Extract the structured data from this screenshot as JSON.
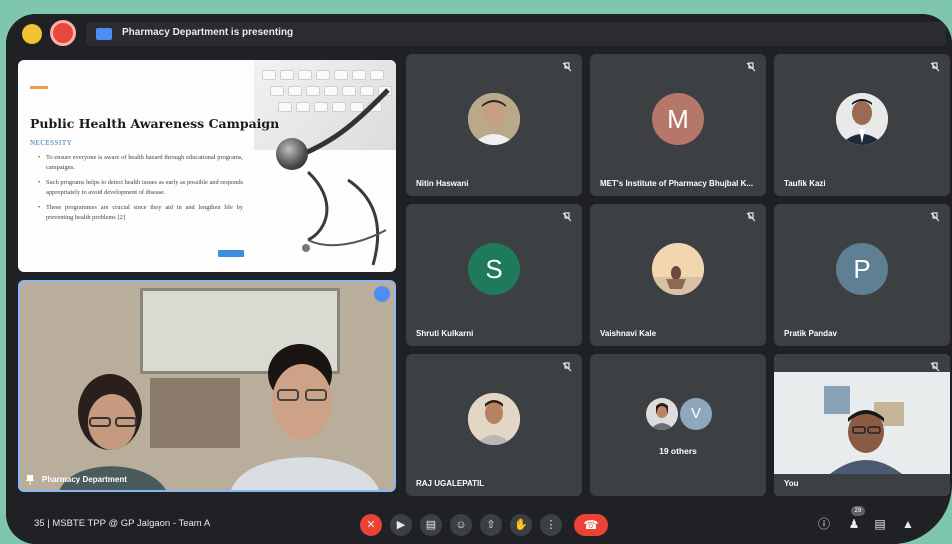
{
  "presenting_banner": "Pharmacy Department is presenting",
  "slide": {
    "title": "Public Health Awareness Campaign",
    "subtitle": "NECESSITY",
    "bullets": [
      "To ensure everyone is aware of health hazard through educational programs, campaigns.",
      "Such programs helps to detect health issues as early as possible and responds appropriately to avoid development of disease.",
      "These programmes are crucial since they aid in and lengthen life by preventing health problems [2]"
    ]
  },
  "main_tile": {
    "name": "Pharmacy Department"
  },
  "participants": [
    {
      "name": "Nitin Haswani",
      "avatar": "photo",
      "letter": ""
    },
    {
      "name": "MET's Institute of Pharmacy Bhujbal K...",
      "avatar": "letter",
      "letter": "M",
      "color": "#b5776a"
    },
    {
      "name": "Taufik Kazi",
      "avatar": "photo",
      "letter": ""
    },
    {
      "name": "Shruti Kulkarni",
      "avatar": "letter",
      "letter": "S",
      "color": "#1f7a5c"
    },
    {
      "name": "Vaishnavi Kale",
      "avatar": "photo",
      "letter": ""
    },
    {
      "name": "Pratik Pandav",
      "avatar": "letter",
      "letter": "P",
      "color": "#5f7f93"
    },
    {
      "name": "RAJ UGALEPATIL",
      "avatar": "photo",
      "letter": ""
    },
    {
      "name": "19 others",
      "avatar": "group",
      "letter": "V"
    },
    {
      "name": "You",
      "avatar": "video",
      "letter": ""
    }
  ],
  "bottom_bar": {
    "meeting": "35  |  MSBTE TPP @ GP Jalgaon - Team A",
    "participant_count": "29"
  },
  "colors": {
    "accent": "#8ab4f8",
    "danger": "#ea4335",
    "tile": "#3c4043"
  }
}
